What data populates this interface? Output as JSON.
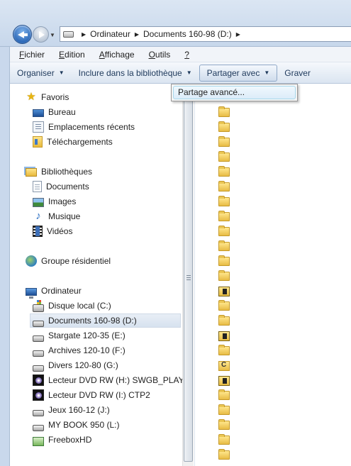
{
  "address_bar": {
    "crumbs": [
      "Ordinateur",
      "Documents 160-98 (D:)"
    ]
  },
  "menubar": {
    "items": [
      {
        "label": "Fichier",
        "accel": "F"
      },
      {
        "label": "Edition",
        "accel": "E"
      },
      {
        "label": "Affichage",
        "accel": "A"
      },
      {
        "label": "Outils",
        "accel": "O"
      },
      {
        "label": "?",
        "accel": "?"
      }
    ]
  },
  "toolbar": {
    "organize": "Organiser",
    "include_library": "Inclure dans la bibliothèque",
    "share_with": "Partager avec",
    "burn": "Graver"
  },
  "dropdown": {
    "items": [
      "Partage avancé..."
    ]
  },
  "navigation": {
    "favorites": {
      "label": "Favoris",
      "items": [
        "Bureau",
        "Emplacements récents",
        "Téléchargements"
      ]
    },
    "libraries": {
      "label": "Bibliothèques",
      "items": [
        "Documents",
        "Images",
        "Musique",
        "Vidéos"
      ]
    },
    "homegroup": {
      "label": "Groupe résidentiel"
    },
    "computer": {
      "label": "Ordinateur",
      "items": [
        "Disque local (C:)",
        "Documents 160-98 (D:)",
        "Stargate 120-35 (E:)",
        "Archives 120-10 (F:)",
        "Divers 120-80 (G:)",
        "Lecteur DVD RW (H:) SWGB_PLAY",
        "Lecteur DVD RW (I:) CTP2",
        "Jeux 160-12 (J:)",
        "MY BOOK 950 (L:)",
        "FreeboxHD"
      ],
      "selected": "Documents 160-98 (D:)"
    }
  }
}
